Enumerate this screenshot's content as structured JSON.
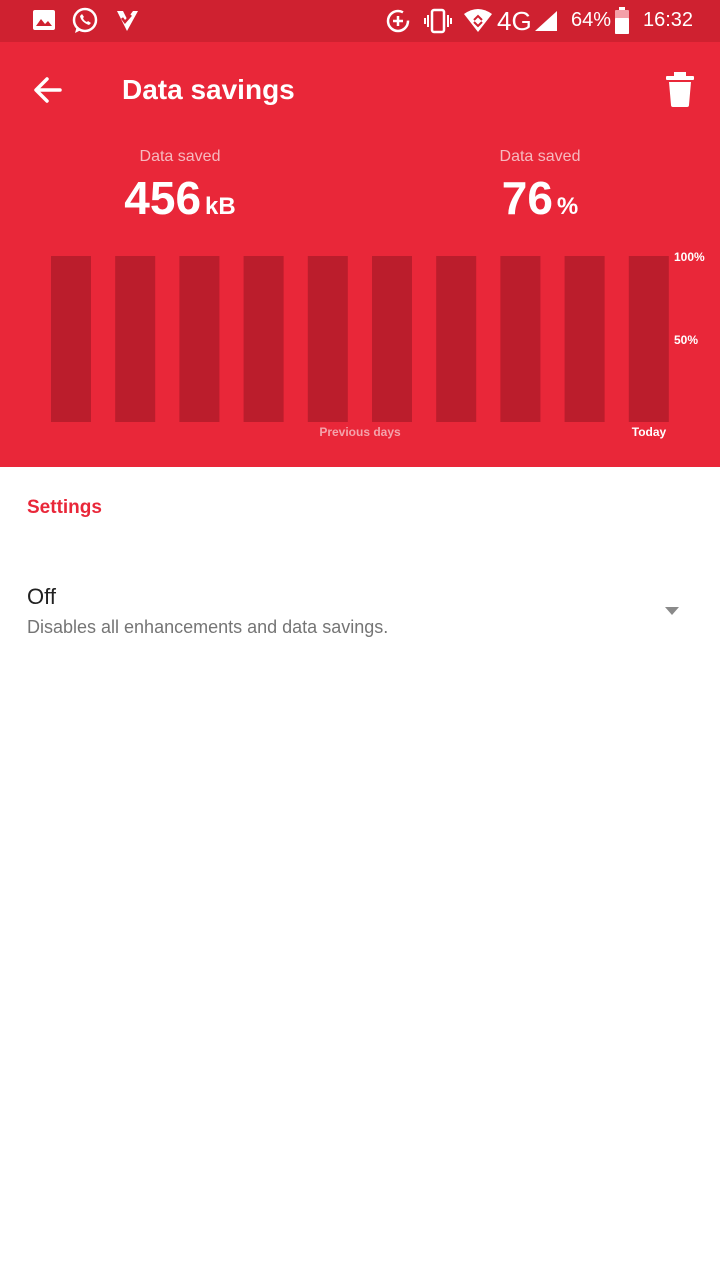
{
  "status_bar": {
    "network": "4G",
    "battery": "64%",
    "time": "16:32",
    "icons": [
      "gallery-icon",
      "whatsapp-icon",
      "check-icon",
      "data-saver-icon",
      "vibrate-icon",
      "wifi-icon",
      "signal-icon",
      "battery-icon"
    ]
  },
  "header": {
    "title": "Data savings",
    "back_icon": "arrow-back-icon",
    "delete_icon": "trash-icon",
    "stats": [
      {
        "label": "Data saved",
        "value": "456",
        "unit": "kB"
      },
      {
        "label": "Data saved",
        "value": "76",
        "unit": "%"
      }
    ]
  },
  "chart_data": {
    "type": "bar",
    "categories": [
      "",
      "",
      "",
      "",
      "",
      "",
      "",
      "",
      "",
      ""
    ],
    "values": [
      100,
      100,
      100,
      100,
      100,
      100,
      100,
      100,
      100,
      100
    ],
    "ylim": [
      0,
      100
    ],
    "y_ticks": [
      "100%",
      "50%"
    ],
    "x_labels": {
      "previous": "Previous days",
      "today": "Today"
    },
    "colors": {
      "bar": "#bb1d2c",
      "background": "#e92739"
    }
  },
  "settings": {
    "section_title": "Settings",
    "mode": {
      "value": "Off",
      "description": "Disables all enhancements and data savings."
    }
  },
  "colors": {
    "accent": "#e92739",
    "status_bar": "#cf2130"
  }
}
